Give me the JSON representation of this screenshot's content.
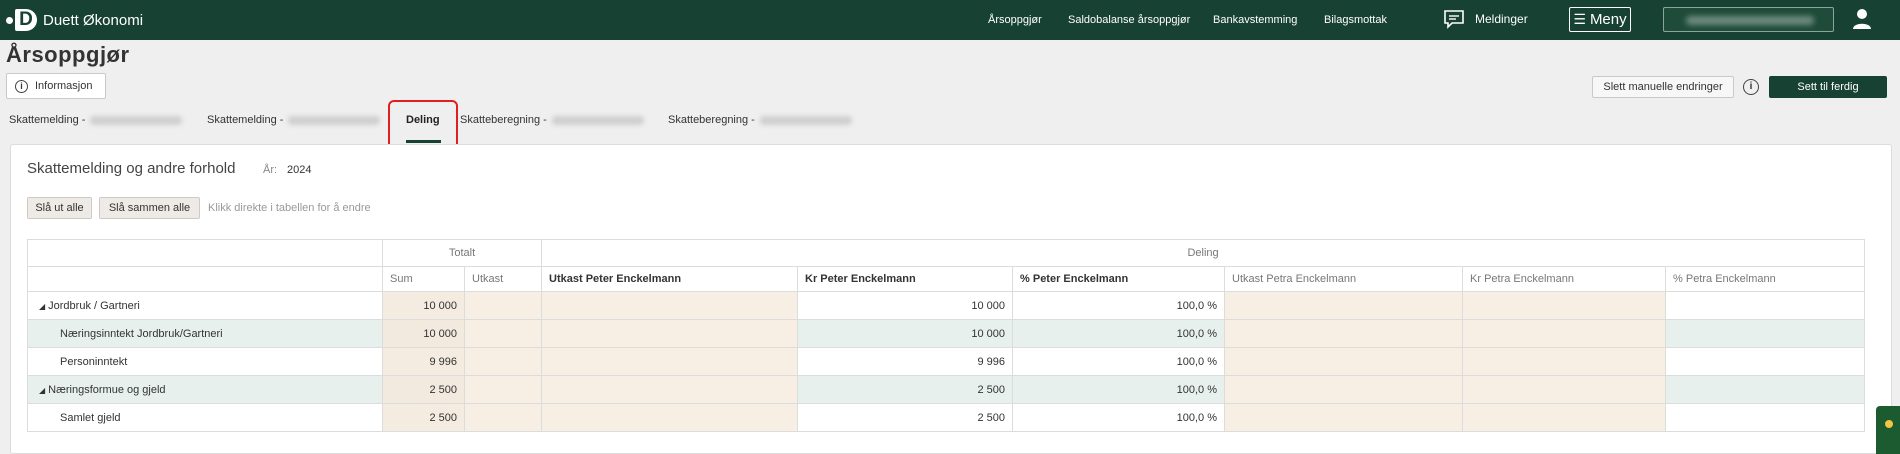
{
  "app": {
    "title": "Duett Økonomi"
  },
  "topnav": {
    "links": [
      "Årsoppgjør",
      "Saldobalanse årsoppgjør",
      "Bankavstemming",
      "Bilagsmottak"
    ],
    "messages": "Meldinger",
    "menu": "Meny"
  },
  "page": {
    "title": "Årsoppgjør",
    "info_button": "Informasjon",
    "delete_button": "Slett manuelle endringer",
    "finish_button": "Sett til ferdig"
  },
  "tabs": [
    "Skattemelding -",
    "Skattemelding -",
    "Deling",
    "Skatteberegning -",
    "Skatteberegning -"
  ],
  "card": {
    "title": "Skattemelding og andre forhold",
    "year_label": "År:",
    "year_value": "2024",
    "expand_all": "Slå ut alle",
    "collapse_all": "Slå sammen alle",
    "hint": "Klikk direkte i tabellen for å endre"
  },
  "table": {
    "group_headers": [
      "Totalt",
      "Deling"
    ],
    "columns": [
      "Sum",
      "Utkast",
      "Utkast Peter Enckelmann",
      "Kr Peter Enckelmann",
      "% Peter Enckelmann",
      "Utkast Petra Enckelmann",
      "Kr Petra Enckelmann",
      "% Petra Enckelmann"
    ],
    "rows": [
      {
        "label": "Jordbruk / Gartneri",
        "sum": "10 000",
        "kr_peter": "10 000",
        "pct_peter": "100,0 %"
      },
      {
        "label": "Næringsinntekt Jordbruk/Gartneri",
        "sum": "10 000",
        "kr_peter": "10 000",
        "pct_peter": "100,0 %"
      },
      {
        "label": "Personinntekt",
        "sum": "9 996",
        "kr_peter": "9 996",
        "pct_peter": "100,0 %"
      },
      {
        "label": "Næringsformue og gjeld",
        "sum": "2 500",
        "kr_peter": "2 500",
        "pct_peter": "100,0 %"
      },
      {
        "label": "Samlet gjeld",
        "sum": "2 500",
        "kr_peter": "2 500",
        "pct_peter": "100,0 %"
      }
    ]
  },
  "colors": {
    "topbar": "#174132",
    "highlight": "#e02020",
    "beige": "#f7efe3"
  },
  "icons": [
    "chat-icon",
    "user-icon",
    "info-icon",
    "hamburger-icon"
  ]
}
